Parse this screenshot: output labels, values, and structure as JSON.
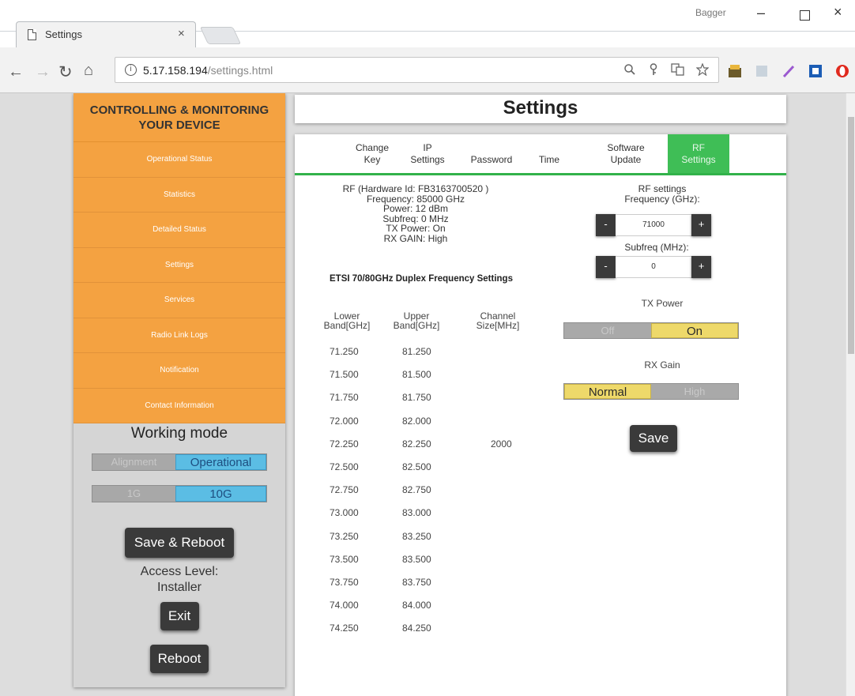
{
  "browser": {
    "tab_title": "Settings",
    "tab_close": "×",
    "profile": "Bagger",
    "window": {
      "minimize": "–",
      "close": "×"
    },
    "url_host": "5.17.158.194",
    "url_path": "/settings.html",
    "nav": {
      "back": "←",
      "forward": "→",
      "reload": "↻",
      "home": "⌂"
    }
  },
  "sidebar": {
    "header": "CONTROLLING & MONITORING YOUR DEVICE",
    "items": [
      "Operational Status",
      "Statistics",
      "Detailed Status",
      "Settings",
      "Services",
      "Radio Link Logs",
      "Notification",
      "Contact Information"
    ],
    "working_mode_title": "Working mode",
    "mode_toggle": {
      "off": "Alignment",
      "on": "Operational"
    },
    "speed_toggle": {
      "off": "1G",
      "on": "10G"
    },
    "save_reboot": "Save & Reboot",
    "access_label": "Access Level:",
    "access_value": "Installer",
    "exit": "Exit",
    "reboot": "Reboot"
  },
  "main": {
    "title": "Settings",
    "tabs": [
      {
        "line1": "Change",
        "line2": "Key"
      },
      {
        "line1": "IP",
        "line2": "Settings"
      },
      {
        "line1": "Password",
        "line2": ""
      },
      {
        "line1": "Time",
        "line2": ""
      },
      {
        "line1": "Software",
        "line2": "Update"
      },
      {
        "line1": "RF",
        "line2": "Settings"
      }
    ],
    "active_tab_color": "#3fbe56",
    "rf_info": [
      "RF (Hardware Id: FB3163700520 )",
      "Frequency: 85000 GHz",
      "Power: 12 dBm",
      "Subfreq: 0 MHz",
      "TX Power: On",
      "RX GAIN: High"
    ],
    "etsi_title": "ETSI 70/80GHz Duplex Frequency Settings",
    "table_headers": {
      "lower": [
        "Lower",
        "Band[GHz]"
      ],
      "upper": [
        "Upper",
        "Band[GHz]"
      ],
      "channel": [
        "Channel",
        "Size[MHz]"
      ]
    },
    "channel_size": "2000",
    "frequencies": [
      {
        "lower": "71.250",
        "upper": "81.250"
      },
      {
        "lower": "71.500",
        "upper": "81.500"
      },
      {
        "lower": "71.750",
        "upper": "81.750"
      },
      {
        "lower": "72.000",
        "upper": "82.000"
      },
      {
        "lower": "72.250",
        "upper": "82.250"
      },
      {
        "lower": "72.500",
        "upper": "82.500"
      },
      {
        "lower": "72.750",
        "upper": "82.750"
      },
      {
        "lower": "73.000",
        "upper": "83.000"
      },
      {
        "lower": "73.250",
        "upper": "83.250"
      },
      {
        "lower": "73.500",
        "upper": "83.500"
      },
      {
        "lower": "73.750",
        "upper": "83.750"
      },
      {
        "lower": "74.000",
        "upper": "84.000"
      },
      {
        "lower": "74.250",
        "upper": "84.250"
      }
    ],
    "rf_settings_label": "RF settings",
    "frequency_label": "Frequency (GHz):",
    "frequency_value": "71000",
    "subfreq_label": "Subfreq (MHz):",
    "subfreq_value": "0",
    "minus": "-",
    "plus": "+",
    "tx_power_label": "TX Power",
    "tx_toggle": {
      "off": "Off",
      "on": "On"
    },
    "rx_gain_label": "RX Gain",
    "rx_toggle": {
      "on": "Normal",
      "off": "High"
    },
    "save": "Save"
  }
}
